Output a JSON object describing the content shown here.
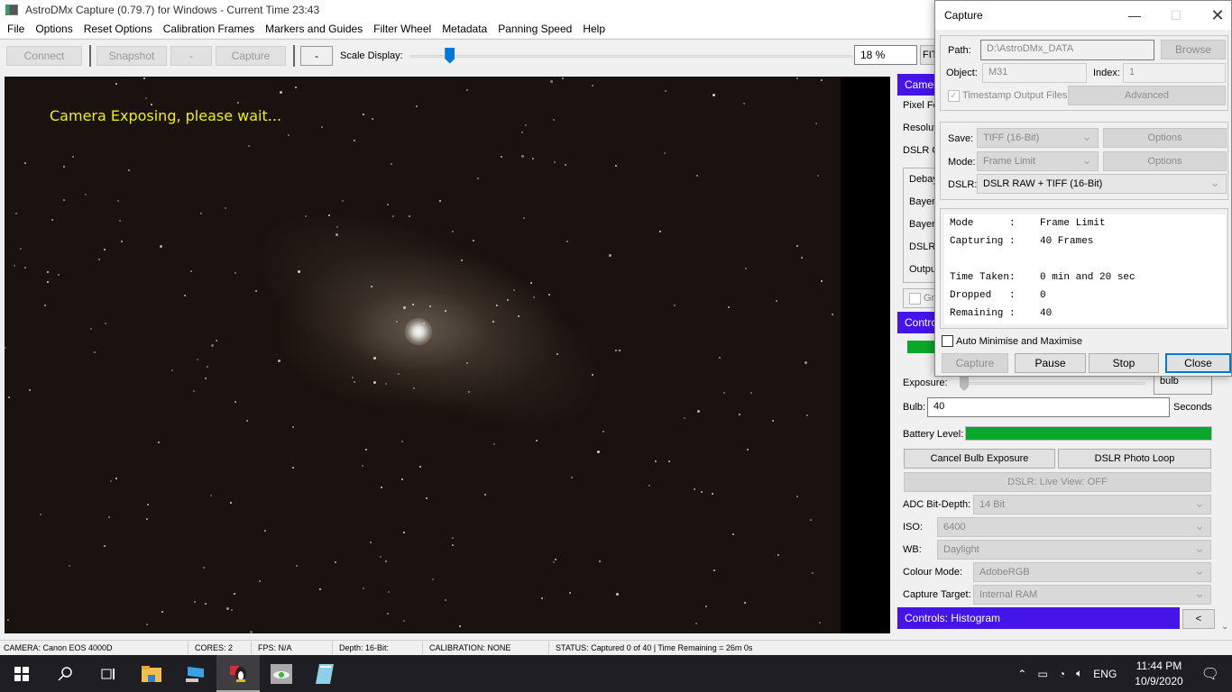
{
  "window": {
    "title": "AstroDMx Capture (0.79.7) for Windows - Current Time 23:43"
  },
  "menu": [
    "File",
    "Options",
    "Reset Options",
    "Calibration Frames",
    "Markers and Guides",
    "Filter Wheel",
    "Metadata",
    "Panning Speed",
    "Help"
  ],
  "toolbar": {
    "connect": "Connect",
    "snapshot": "Snapshot",
    "dash1": "-",
    "capture": "Capture",
    "dash2": "-",
    "scale_label": "Scale Display:",
    "scale_percent": 18,
    "zoom_value": "18 %",
    "fit": "FIT"
  },
  "viewer": {
    "overlay": "Camera Exposing, please wait..."
  },
  "side": {
    "camera_header": "Camera",
    "pixel_format": "Pixel Fo",
    "resolution": "Resolut",
    "dslr_o": "DSLR O",
    "debay": "Debay",
    "bayer1": "Bayer",
    "bayer2": "Bayer",
    "dslr": "DSLR",
    "output": "Output",
    "grid_check": "Gr",
    "controls_header": "Control",
    "exposure_label": "Exposure:",
    "exposure_mode": "bulb",
    "bulb_label": "Bulb:",
    "bulb_value": "40",
    "bulb_unit": "Seconds",
    "battery_label": "Battery Level:",
    "battery_level_percent": 100,
    "cancel_bulb": "Cancel Bulb Exposure",
    "photo_loop": "DSLR Photo Loop",
    "live_view": "DSLR: Live View: OFF",
    "adc_label": "ADC Bit-Depth:",
    "adc_value": "14 Bit",
    "iso_label": "ISO:",
    "iso_value": "6400",
    "wb_label": "WB:",
    "wb_value": "Daylight",
    "colour_label": "Colour Mode:",
    "colour_value": "AdobeRGB",
    "target_label": "Capture Target:",
    "target_value": "Internal RAM",
    "histogram_header": "Controls: Histogram",
    "collapse": "<"
  },
  "dialog": {
    "title": "Capture",
    "path_label": "Path:",
    "path_value": "D:\\AstroDMx_DATA",
    "browse": "Browse",
    "object_label": "Object:",
    "object_value": "M31",
    "index_label": "Index:",
    "index_value": "1",
    "timestamp": "Timestamp Output Files",
    "advanced": "Advanced",
    "save_label": "Save:",
    "save_value": "TIFF (16-Bit)",
    "save_options": "Options",
    "mode_label": "Mode:",
    "mode_value": "Frame Limit",
    "mode_options": "Options",
    "dslr_label": "DSLR:",
    "dslr_value": "DSLR RAW + TIFF (16-Bit)",
    "info": [
      {
        "k": "Mode      :",
        "v": "Frame Limit"
      },
      {
        "k": "Capturing :",
        "v": "40 Frames"
      },
      {
        "k": "",
        "v": ""
      },
      {
        "k": "Time Taken:",
        "v": "0 min and 20 sec"
      },
      {
        "k": "Dropped   :",
        "v": "0"
      },
      {
        "k": "Remaining :",
        "v": "40"
      }
    ],
    "auto_min": "Auto Minimise and Maximise",
    "btn_capture": "Capture",
    "btn_pause": "Pause",
    "btn_stop": "Stop",
    "btn_close": "Close"
  },
  "status": {
    "camera": "CAMERA: Canon EOS 4000D",
    "cores": "CORES: 2",
    "fps": "FPS: N/A",
    "depth": "Depth: 16-Bit:",
    "calibration": "CALIBRATION: NONE",
    "status": "STATUS: Captured 0  of 40 | Time Remaining = 26m 0s"
  },
  "taskbar": {
    "lang": "ENG",
    "time": "11:44 PM",
    "date": "10/9/2020"
  },
  "colors": {
    "accent_header": "#4414e8",
    "battery": "#0aa82a",
    "overlay_text": "#f0f000"
  }
}
